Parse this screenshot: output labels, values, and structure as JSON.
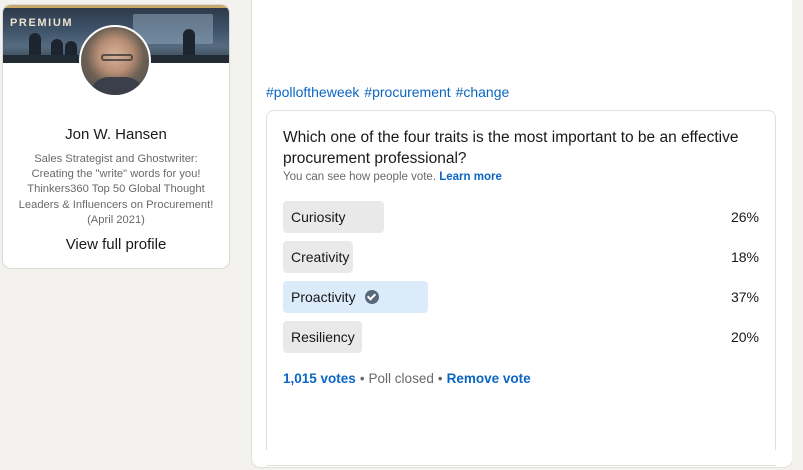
{
  "profile": {
    "premium_label": "PREMIUM",
    "name": "Jon W. Hansen",
    "headline": "Sales Strategist and Ghostwriter: Creating the \"write\" words for you! Thinkers360 Top 50 Global Thought Leaders & Influencers on Procurement! (April 2021)",
    "view_profile_label": "View full profile"
  },
  "post": {
    "hashtags": [
      "#polloftheweek",
      "#procurement",
      "#change"
    ],
    "poll": {
      "question": "Which one of the four traits is the most important to be an effective procurement professional?",
      "visibility_note": "You can see how people vote.",
      "learn_more_label": "Learn more",
      "options": [
        {
          "label": "Curiosity",
          "percent": "26%",
          "value": 26,
          "selected": false
        },
        {
          "label": "Creativity",
          "percent": "18%",
          "value": 18,
          "selected": false
        },
        {
          "label": "Proactivity",
          "percent": "37%",
          "value": 37,
          "selected": true
        },
        {
          "label": "Resiliency",
          "percent": "20%",
          "value": 20,
          "selected": false
        }
      ],
      "votes_label": "1,015 votes",
      "status": "Poll closed",
      "separator": "•",
      "remove_vote_label": "Remove vote"
    }
  },
  "colors": {
    "link": "#0a66c2",
    "page_bg": "#f3f2ef",
    "bar_default": "#e9e9e9",
    "bar_selected": "#dcebf9",
    "premium_gold": "#c8a96a"
  },
  "icons": {
    "selected_option": "check-circle-icon"
  }
}
